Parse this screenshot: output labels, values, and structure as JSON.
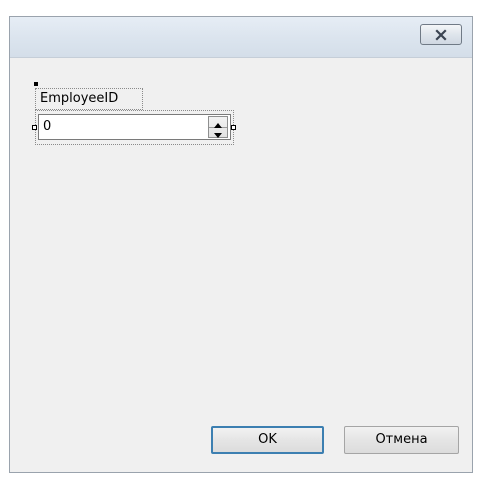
{
  "window": {
    "close_icon": "close-icon"
  },
  "form": {
    "label": "EmployeeID",
    "numeric_value": "0"
  },
  "buttons": {
    "ok_label": "OK",
    "cancel_label": "Отмена"
  },
  "colors": {
    "titlebar": "#dbe4ee",
    "body": "#f0f0f0",
    "ok_border": "#3c7fb1"
  }
}
